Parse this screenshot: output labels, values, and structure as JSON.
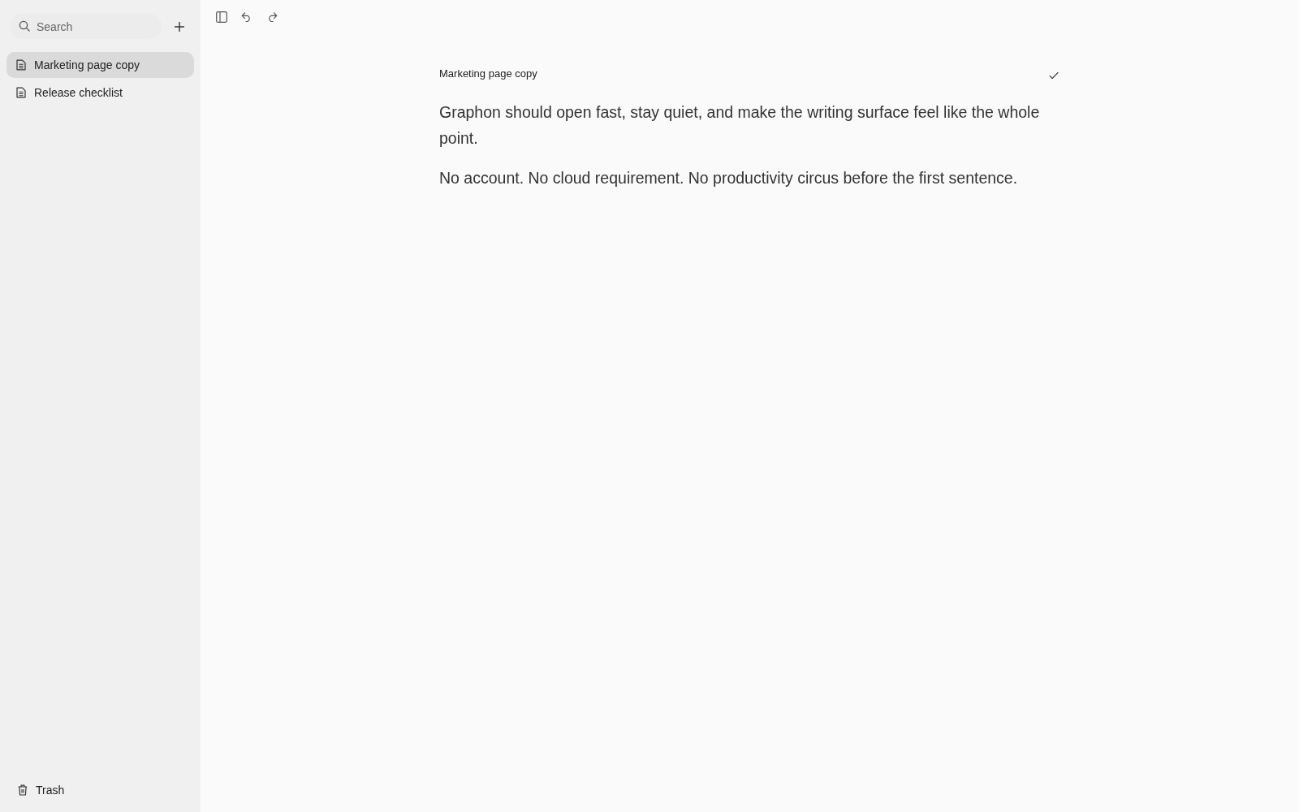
{
  "sidebar": {
    "search": {
      "placeholder": "Search"
    },
    "notes": [
      {
        "title": "Marketing page copy",
        "selected": true
      },
      {
        "title": "Release checklist",
        "selected": false
      }
    ],
    "trash": {
      "label": "Trash"
    }
  },
  "editor": {
    "title": "Marketing page copy",
    "paragraphs": [
      "Graphon should open fast, stay quiet, and make the writing surface feel like the whole point.",
      "No account. No cloud requirement. No productivity circus before the first sentence."
    ]
  }
}
